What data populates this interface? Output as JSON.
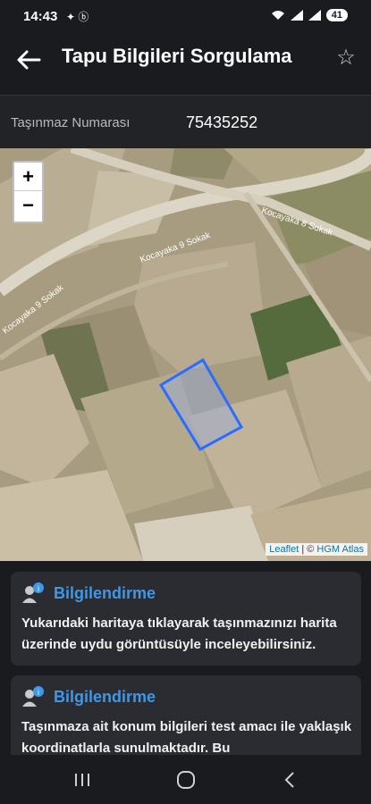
{
  "status_bar": {
    "time": "14:43",
    "battery": "41"
  },
  "app_bar": {
    "title": "Tapu Bilgileri Sorgulama"
  },
  "parcel": {
    "label": "Taşınmaz Numarası",
    "value": "75435252"
  },
  "map": {
    "zoom_in": "+",
    "zoom_out": "−",
    "streets": [
      "Kocayaka 8 Sokak",
      "Kocayaka 9 Sokak",
      "Kocayaka 9 Sokak"
    ],
    "attribution": {
      "leaflet": "Leaflet",
      "separator": " | © ",
      "provider": "HGM Atlas"
    }
  },
  "cards": [
    {
      "title": "Bilgilendirme",
      "text": "Yukarıdaki haritaya tıklayarak taşınmazınızı harita üzerinde uydu görüntüsüyle inceleyebilirsiniz."
    },
    {
      "title": "Bilgilendirme",
      "text": "Taşınmaza ait konum bilgileri test amacı ile yaklaşık koordinatlarla sunulmaktadır. Bu"
    }
  ],
  "colors": {
    "accent": "#3f97e6",
    "parcel_outline": "#2b6cff",
    "background": "#1a1b1f"
  }
}
